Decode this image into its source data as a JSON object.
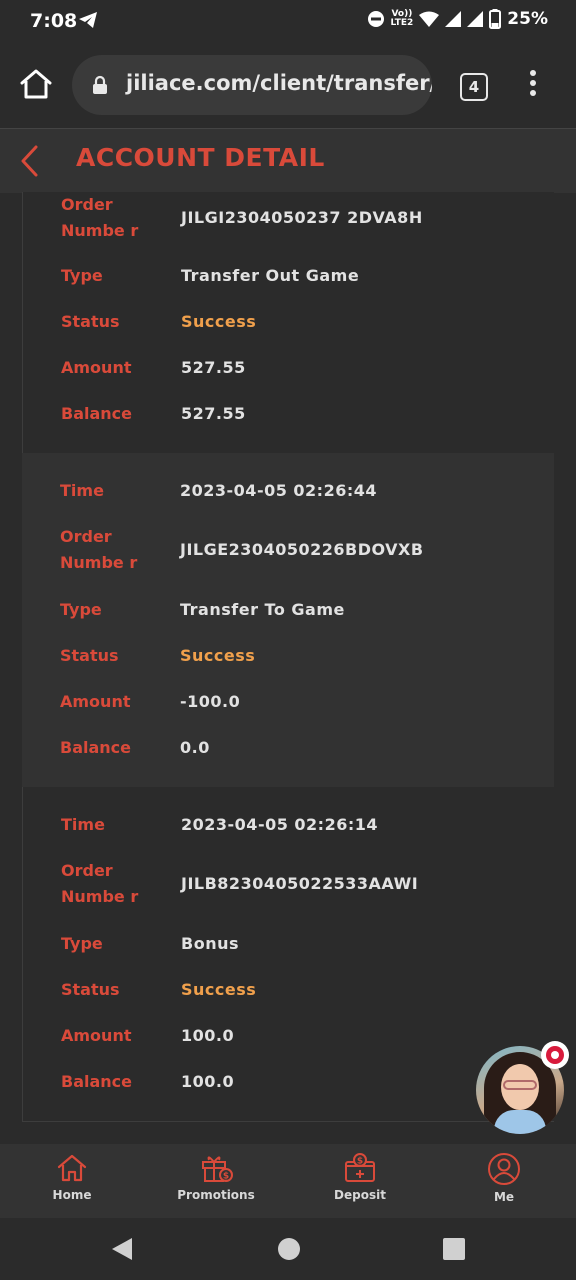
{
  "status_bar": {
    "time": "7:08",
    "volte_top": "Vo))",
    "volte_bottom": "LTE2",
    "battery": "25%"
  },
  "browser": {
    "url": "jiliace.com/client/transfer/cred",
    "tab_count": "4"
  },
  "header": {
    "title": "ACCOUNT DETAIL"
  },
  "records": [
    {
      "order_label": "Order Numbe r",
      "order_value": "JILGI2304050237 2DVA8H",
      "type_label": "Type",
      "type_value": "Transfer Out Game",
      "status_label": "Status",
      "status_value": "Success",
      "amount_label": "Amount",
      "amount_value": "527.55",
      "balance_label": "Balance",
      "balance_value": "527.55"
    },
    {
      "time_label": "Time",
      "time_value": "2023-04-05 02:26:44",
      "order_label": "Order Numbe r",
      "order_value": "JILGE2304050226BDOVXB",
      "type_label": "Type",
      "type_value": "Transfer To Game",
      "status_label": "Status",
      "status_value": "Success",
      "amount_label": "Amount",
      "amount_value": "-100.0",
      "balance_label": "Balance",
      "balance_value": "0.0"
    },
    {
      "time_label": "Time",
      "time_value": "2023-04-05 02:26:14",
      "order_label": "Order Numbe r",
      "order_value": "JILB8230405022533AAWI",
      "type_label": "Type",
      "type_value": "Bonus",
      "status_label": "Status",
      "status_value": "Success",
      "amount_label": "Amount",
      "amount_value": "100.0",
      "balance_label": "Balance",
      "balance_value": "100.0"
    }
  ],
  "bottom_nav": {
    "home": "Home",
    "promotions": "Promotions",
    "deposit": "Deposit",
    "me": "Me"
  },
  "colors": {
    "accent": "#d94a3a",
    "success": "#f0a04c",
    "background": "#2b2b2b"
  }
}
